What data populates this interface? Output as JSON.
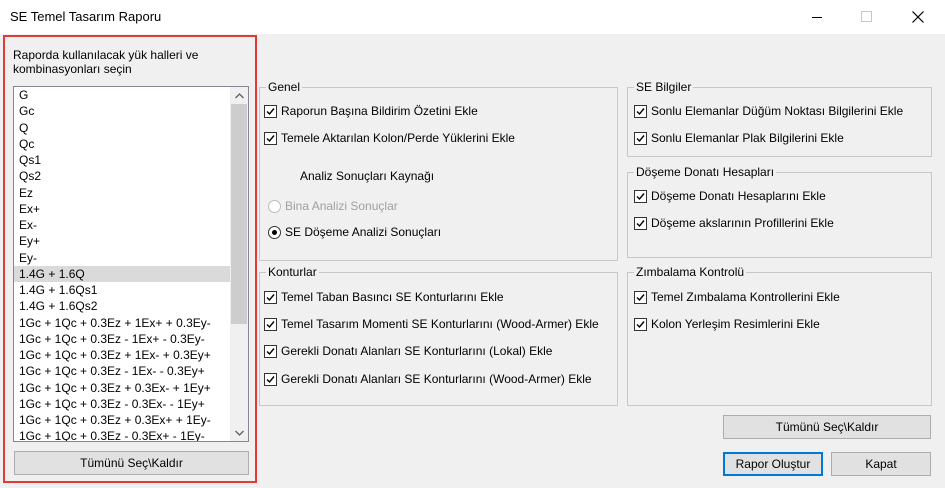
{
  "window": {
    "title": "SE Temel Tasarım Raporu"
  },
  "left": {
    "label": "Raporda kullanılacak yük halleri ve kombinasyonları seçin",
    "items": [
      "G",
      "Gc",
      "Q",
      "Qc",
      "Qs1",
      "Qs2",
      "Ez",
      "Ex+",
      "Ex-",
      "Ey+",
      "Ey-",
      "1.4G + 1.6Q",
      "1.4G + 1.6Qs1",
      "1.4G + 1.6Qs2",
      "1Gc + 1Qc + 0.3Ez + 1Ex+ + 0.3Ey-",
      "1Gc + 1Qc + 0.3Ez - 1Ex+ - 0.3Ey-",
      "1Gc + 1Qc + 0.3Ez + 1Ex- + 0.3Ey+",
      "1Gc + 1Qc + 0.3Ez - 1Ex- - 0.3Ey+",
      "1Gc + 1Qc + 0.3Ez + 0.3Ex- + 1Ey+",
      "1Gc + 1Qc + 0.3Ez - 0.3Ex- - 1Ey+",
      "1Gc + 1Qc + 0.3Ez + 0.3Ex+ + 1Ey-",
      "1Gc + 1Qc + 0.3Ez - 0.3Ex+ - 1Ey-"
    ],
    "selected_item": "1.4G + 1.6Q",
    "select_all_label": "Tümünü Seç\\Kaldır"
  },
  "genel": {
    "title": "Genel",
    "cb1": "Raporun Başına Bildirim Özetini Ekle",
    "cb2": "Temele Aktarılan Kolon/Perde Yüklerini Ekle",
    "source_label": "Analiz Sonuçları Kaynağı",
    "radio1": "Bina Analizi Sonuçlar",
    "radio2": "SE Döşeme Analizi Sonuçları"
  },
  "se_bilgiler": {
    "title": "SE Bilgiler",
    "cb1": "Sonlu Elemanlar Düğüm Noktası Bilgilerini Ekle",
    "cb2": "Sonlu Elemanlar Plak Bilgilerini Ekle"
  },
  "doseme": {
    "title": "Döşeme Donatı Hesapları",
    "cb1": "Döşeme Donatı Hesaplarını Ekle",
    "cb2": "Döşeme akslarının Profillerini Ekle"
  },
  "konturlar": {
    "title": "Konturlar",
    "cb1": "Temel Taban Basıncı SE Konturlarını Ekle",
    "cb2": "Temel Tasarım Momenti SE Konturlarını (Wood-Armer) Ekle",
    "cb3": "Gerekli Donatı Alanları SE Konturlarını (Lokal) Ekle",
    "cb4": "Gerekli Donatı Alanları SE Konturlarını (Wood-Armer) Ekle"
  },
  "zimbalama": {
    "title": "Zımbalama Kontrolü",
    "cb1": "Temel Zımbalama Kontrollerini Ekle",
    "cb2": "Kolon Yerleşim Resimlerini Ekle"
  },
  "buttons": {
    "select_all": "Tümünü Seç\\Kaldır",
    "create_report": "Rapor Oluştur",
    "close": "Kapat"
  }
}
